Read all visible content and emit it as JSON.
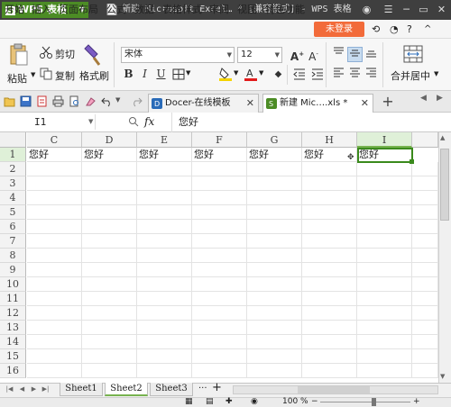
{
  "app": {
    "name": "WPS 表格",
    "doc_title": "新建 Microsoft Excel… * [兼容模式] - WPS 表格"
  },
  "menu": {
    "items": [
      "开始",
      "插入",
      "页面布局",
      "公式",
      "数据",
      "表格样式",
      "审阅",
      "视图",
      "特色功能"
    ],
    "login": "未登录"
  },
  "ribbon": {
    "paste_label": "粘贴",
    "cut_label": "剪切",
    "copy_label": "复制",
    "format_painter_label": "格式刷",
    "font_name": "宋体",
    "font_size": "12",
    "bold": "B",
    "italic": "I",
    "underline": "U",
    "merge_label": "合并居中"
  },
  "doc_tabs": [
    {
      "label": "Docer-在线模板"
    },
    {
      "label": "新建 Mic….xls *"
    }
  ],
  "formula": {
    "cell_ref": "I1",
    "fx": "fx",
    "value": "您好"
  },
  "grid": {
    "columns": [
      "C",
      "D",
      "E",
      "F",
      "G",
      "H",
      "I"
    ],
    "rows": [
      "1",
      "2",
      "3",
      "4",
      "5",
      "6",
      "7",
      "8",
      "9",
      "10",
      "11",
      "12",
      "13",
      "14",
      "15",
      "16"
    ],
    "row1_values": [
      "您好",
      "您好",
      "您好",
      "您好",
      "您好",
      "您好",
      "您好"
    ],
    "active_cell": "I1"
  },
  "sheets": {
    "tabs": [
      "Sheet1",
      "Sheet2",
      "Sheet3"
    ],
    "active": "Sheet2",
    "more": "···",
    "add": "+"
  },
  "status": {
    "zoom": "100 %"
  },
  "colors": {
    "brand_green": "#4c8c25",
    "login_orange": "#f26b3a",
    "selection_green": "#3a8a1c"
  },
  "icons": [
    "paste-icon",
    "scissors-icon",
    "copy-icon",
    "brush-icon",
    "fill-color-icon",
    "font-color-icon",
    "border-icon",
    "align-left-icon",
    "align-center-icon",
    "align-right-icon",
    "merge-cells-icon",
    "close-icon",
    "save-icon",
    "undo-icon",
    "redo-icon",
    "search-icon"
  ]
}
